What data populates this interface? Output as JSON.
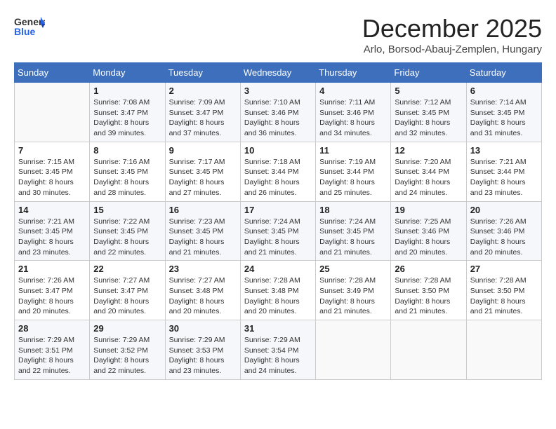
{
  "header": {
    "logo_line1": "General",
    "logo_line2": "Blue",
    "month_title": "December 2025",
    "subtitle": "Arlo, Borsod-Abauj-Zemplen, Hungary"
  },
  "weekdays": [
    "Sunday",
    "Monday",
    "Tuesday",
    "Wednesday",
    "Thursday",
    "Friday",
    "Saturday"
  ],
  "weeks": [
    [
      {
        "day": "",
        "info": ""
      },
      {
        "day": "1",
        "info": "Sunrise: 7:08 AM\nSunset: 3:47 PM\nDaylight: 8 hours\nand 39 minutes."
      },
      {
        "day": "2",
        "info": "Sunrise: 7:09 AM\nSunset: 3:47 PM\nDaylight: 8 hours\nand 37 minutes."
      },
      {
        "day": "3",
        "info": "Sunrise: 7:10 AM\nSunset: 3:46 PM\nDaylight: 8 hours\nand 36 minutes."
      },
      {
        "day": "4",
        "info": "Sunrise: 7:11 AM\nSunset: 3:46 PM\nDaylight: 8 hours\nand 34 minutes."
      },
      {
        "day": "5",
        "info": "Sunrise: 7:12 AM\nSunset: 3:45 PM\nDaylight: 8 hours\nand 32 minutes."
      },
      {
        "day": "6",
        "info": "Sunrise: 7:14 AM\nSunset: 3:45 PM\nDaylight: 8 hours\nand 31 minutes."
      }
    ],
    [
      {
        "day": "7",
        "info": "Sunrise: 7:15 AM\nSunset: 3:45 PM\nDaylight: 8 hours\nand 30 minutes."
      },
      {
        "day": "8",
        "info": "Sunrise: 7:16 AM\nSunset: 3:45 PM\nDaylight: 8 hours\nand 28 minutes."
      },
      {
        "day": "9",
        "info": "Sunrise: 7:17 AM\nSunset: 3:45 PM\nDaylight: 8 hours\nand 27 minutes."
      },
      {
        "day": "10",
        "info": "Sunrise: 7:18 AM\nSunset: 3:44 PM\nDaylight: 8 hours\nand 26 minutes."
      },
      {
        "day": "11",
        "info": "Sunrise: 7:19 AM\nSunset: 3:44 PM\nDaylight: 8 hours\nand 25 minutes."
      },
      {
        "day": "12",
        "info": "Sunrise: 7:20 AM\nSunset: 3:44 PM\nDaylight: 8 hours\nand 24 minutes."
      },
      {
        "day": "13",
        "info": "Sunrise: 7:21 AM\nSunset: 3:44 PM\nDaylight: 8 hours\nand 23 minutes."
      }
    ],
    [
      {
        "day": "14",
        "info": "Sunrise: 7:21 AM\nSunset: 3:45 PM\nDaylight: 8 hours\nand 23 minutes."
      },
      {
        "day": "15",
        "info": "Sunrise: 7:22 AM\nSunset: 3:45 PM\nDaylight: 8 hours\nand 22 minutes."
      },
      {
        "day": "16",
        "info": "Sunrise: 7:23 AM\nSunset: 3:45 PM\nDaylight: 8 hours\nand 21 minutes."
      },
      {
        "day": "17",
        "info": "Sunrise: 7:24 AM\nSunset: 3:45 PM\nDaylight: 8 hours\nand 21 minutes."
      },
      {
        "day": "18",
        "info": "Sunrise: 7:24 AM\nSunset: 3:45 PM\nDaylight: 8 hours\nand 21 minutes."
      },
      {
        "day": "19",
        "info": "Sunrise: 7:25 AM\nSunset: 3:46 PM\nDaylight: 8 hours\nand 20 minutes."
      },
      {
        "day": "20",
        "info": "Sunrise: 7:26 AM\nSunset: 3:46 PM\nDaylight: 8 hours\nand 20 minutes."
      }
    ],
    [
      {
        "day": "21",
        "info": "Sunrise: 7:26 AM\nSunset: 3:47 PM\nDaylight: 8 hours\nand 20 minutes."
      },
      {
        "day": "22",
        "info": "Sunrise: 7:27 AM\nSunset: 3:47 PM\nDaylight: 8 hours\nand 20 minutes."
      },
      {
        "day": "23",
        "info": "Sunrise: 7:27 AM\nSunset: 3:48 PM\nDaylight: 8 hours\nand 20 minutes."
      },
      {
        "day": "24",
        "info": "Sunrise: 7:28 AM\nSunset: 3:48 PM\nDaylight: 8 hours\nand 20 minutes."
      },
      {
        "day": "25",
        "info": "Sunrise: 7:28 AM\nSunset: 3:49 PM\nDaylight: 8 hours\nand 21 minutes."
      },
      {
        "day": "26",
        "info": "Sunrise: 7:28 AM\nSunset: 3:50 PM\nDaylight: 8 hours\nand 21 minutes."
      },
      {
        "day": "27",
        "info": "Sunrise: 7:28 AM\nSunset: 3:50 PM\nDaylight: 8 hours\nand 21 minutes."
      }
    ],
    [
      {
        "day": "28",
        "info": "Sunrise: 7:29 AM\nSunset: 3:51 PM\nDaylight: 8 hours\nand 22 minutes."
      },
      {
        "day": "29",
        "info": "Sunrise: 7:29 AM\nSunset: 3:52 PM\nDaylight: 8 hours\nand 22 minutes."
      },
      {
        "day": "30",
        "info": "Sunrise: 7:29 AM\nSunset: 3:53 PM\nDaylight: 8 hours\nand 23 minutes."
      },
      {
        "day": "31",
        "info": "Sunrise: 7:29 AM\nSunset: 3:54 PM\nDaylight: 8 hours\nand 24 minutes."
      },
      {
        "day": "",
        "info": ""
      },
      {
        "day": "",
        "info": ""
      },
      {
        "day": "",
        "info": ""
      }
    ]
  ]
}
